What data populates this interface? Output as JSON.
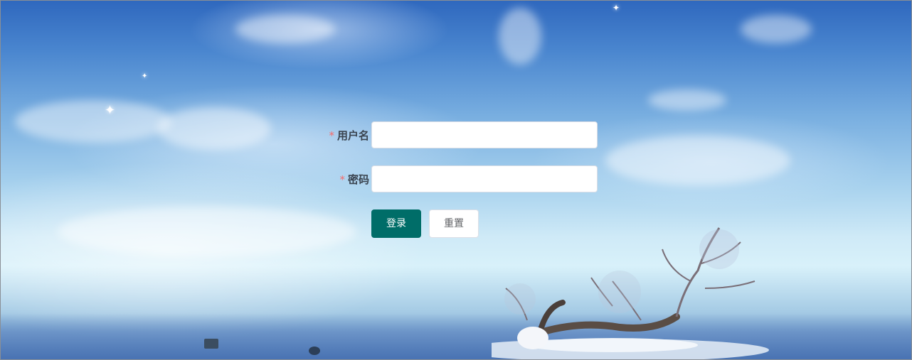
{
  "login_form": {
    "username": {
      "required_mark": "*",
      "label": "用户名",
      "value": "",
      "placeholder": ""
    },
    "password": {
      "required_mark": "*",
      "label": "密码",
      "value": "",
      "placeholder": ""
    },
    "login_button_label": "登录",
    "reset_button_label": "重置"
  },
  "colors": {
    "primary_button": "#006d68",
    "required_asterisk": "#f56c6c",
    "label_text": "#3a4450"
  }
}
